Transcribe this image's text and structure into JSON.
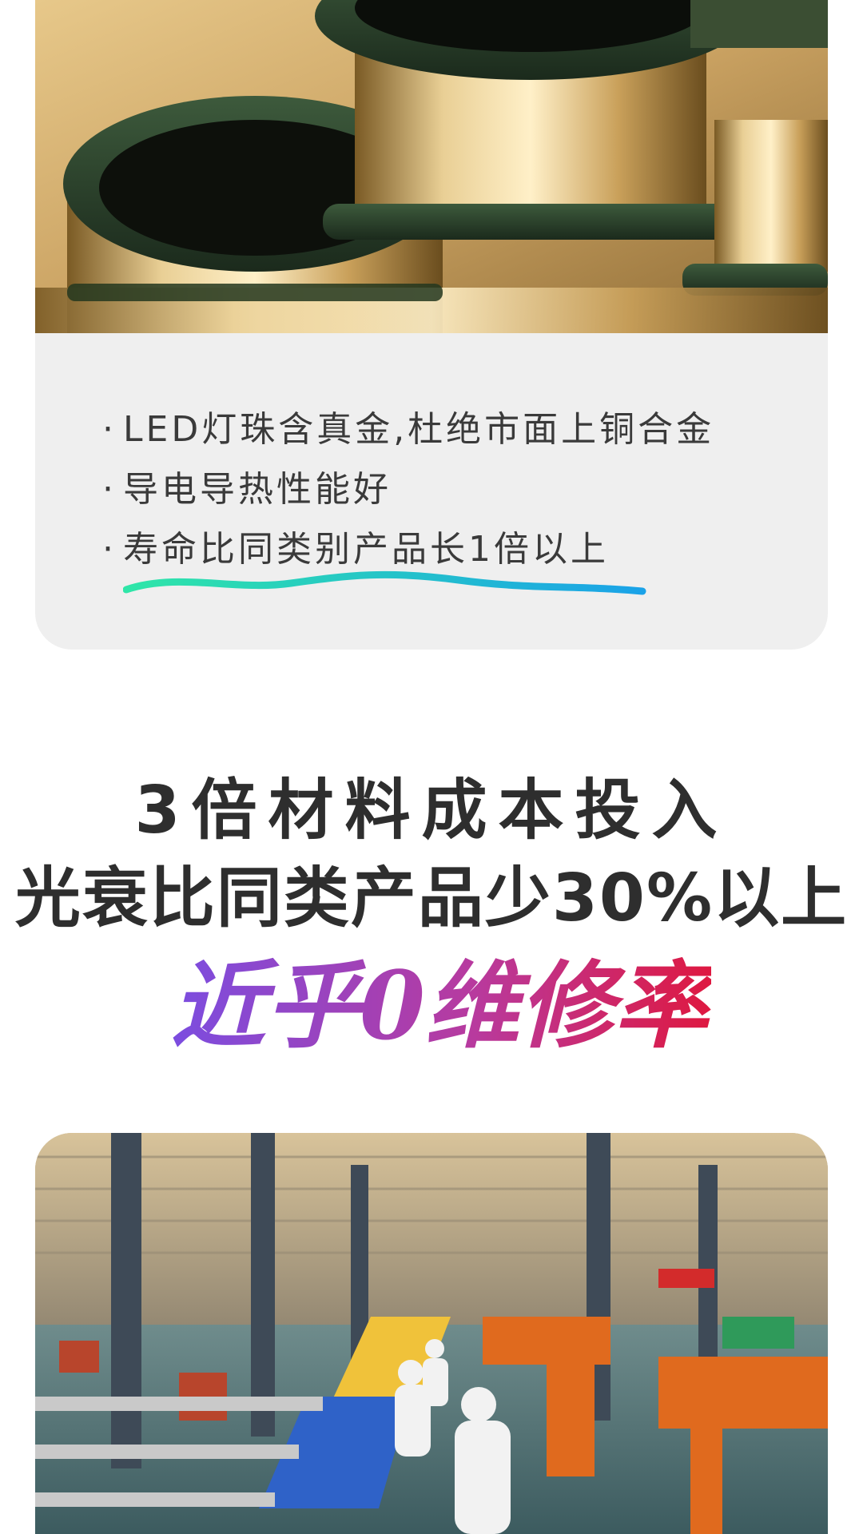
{
  "feature_card": {
    "photo_alt": "gold-wire-spools",
    "bullets": [
      {
        "marker": "·",
        "text": "LED灯珠含真金,杜绝市面上铜合金"
      },
      {
        "marker": "·",
        "text": "导电导热性能好"
      },
      {
        "marker": "·",
        "text": "寿命比同类别产品长1倍以上"
      }
    ]
  },
  "headline": {
    "line1": "3倍材料成本投入",
    "line2": "光衰比同类产品少30%以上",
    "brush_text": "近乎0维修率"
  },
  "factory": {
    "photo_alt": "production-line-factory"
  },
  "colors": {
    "card_bg": "#efefef",
    "text_dark": "#2e2e2e",
    "bullet_text": "#3a3a3a",
    "wave_start": "#2fe6a8",
    "wave_end": "#1aa2e8",
    "brush_start": "#7b4de0",
    "brush_end": "#e0173c"
  }
}
